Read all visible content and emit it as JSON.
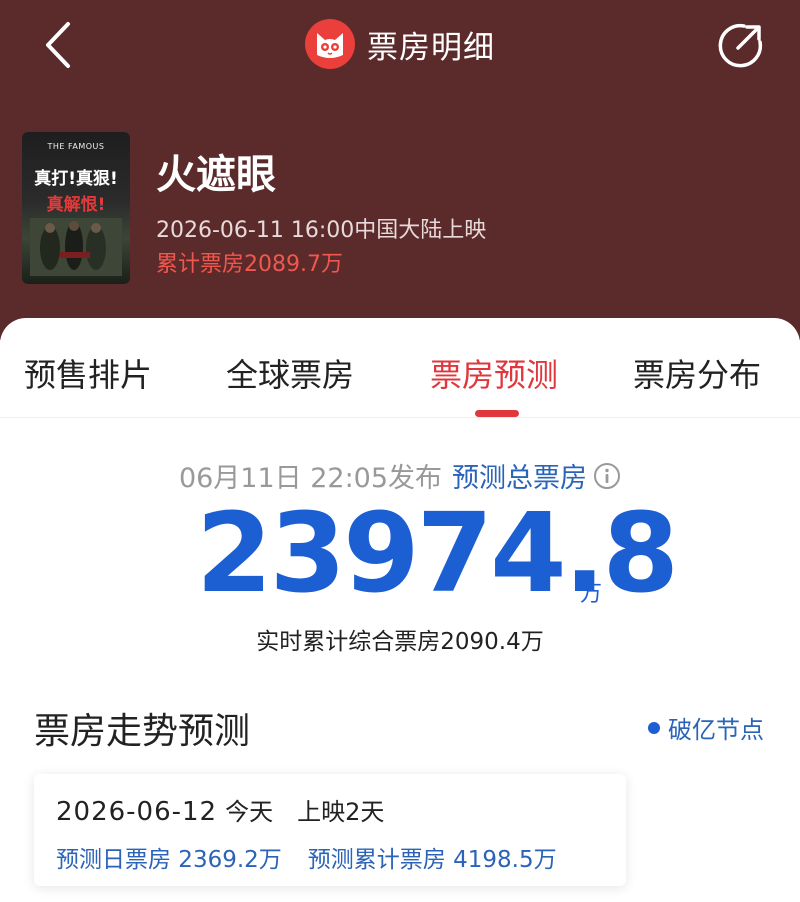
{
  "header": {
    "title": "票房明细"
  },
  "movie": {
    "poster_en": "THE FAMOUS",
    "poster_line1": "真打!真狠!",
    "poster_line2": "真解恨!",
    "title": "火遮眼",
    "release_info": "2026-06-11 16:00中国大陆上映",
    "cumulative": "累计票房2089.7万"
  },
  "tabs": [
    {
      "label": "预售排片"
    },
    {
      "label": "全球票房"
    },
    {
      "label": "票房预测"
    },
    {
      "label": "票房分布"
    }
  ],
  "active_tab": "票房预测",
  "forecast": {
    "published_time": "06月11日 22:05发布",
    "label": "预测总票房",
    "value": "23974.8",
    "unit": "万",
    "realtime": "实时累计综合票房2090.4万"
  },
  "trend": {
    "title": "票房走势预测",
    "legend": "破亿节点"
  },
  "card": {
    "date": "2026-06-12",
    "day": "今天",
    "days_screened": "上映2天",
    "daily": "预测日票房 2369.2万",
    "total": "预测累计票房 4198.5万"
  },
  "colors": {
    "header_bg": "#5b2a2b",
    "accent_red": "#e0373e",
    "accent_blue": "#1c5fd3",
    "link_blue": "#2a63b8"
  },
  "icons": {
    "back": "chevron-left-icon",
    "share": "share-icon",
    "logo": "cat-logo-icon",
    "info": "info-icon"
  }
}
